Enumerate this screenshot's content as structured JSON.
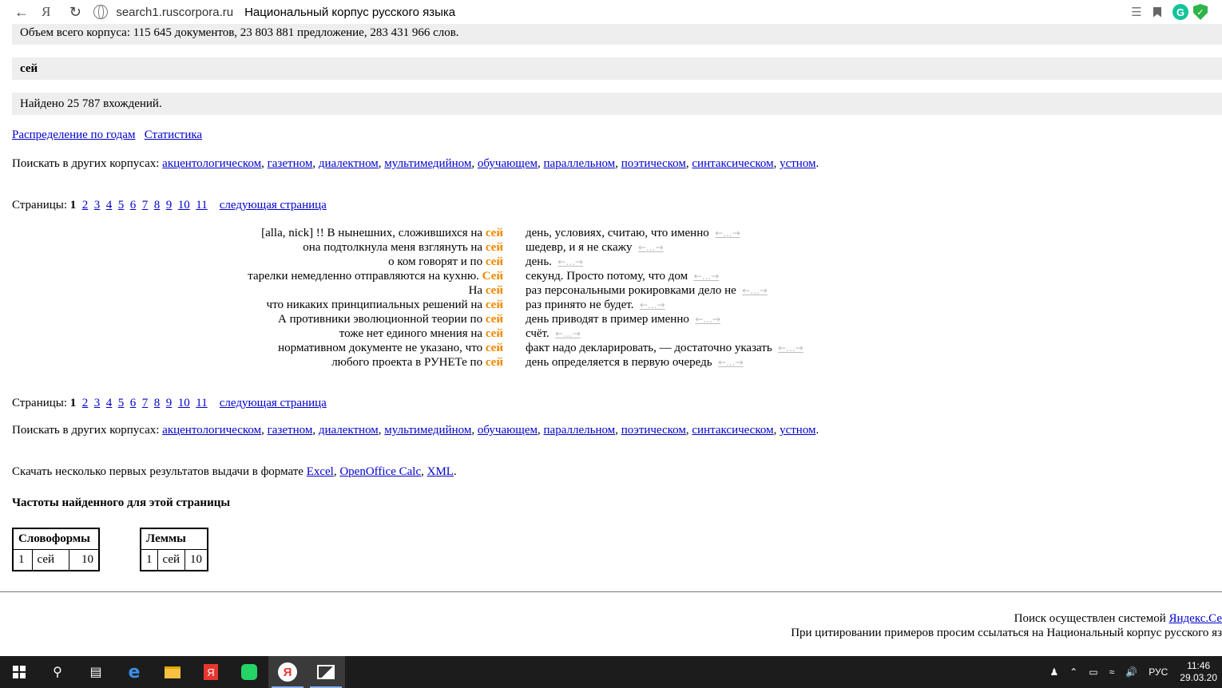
{
  "browser": {
    "url": "search1.ruscorpora.ru",
    "title": "Национальный корпус русского языка",
    "yandex_letter": "Я",
    "grammarly_letter": "G"
  },
  "summary": {
    "corpus_size": "Объем всего корпуса: 115 645 документов, 23 803 881 предложение, 283 431 966 слов.",
    "query": "сей",
    "found": "Найдено 25 787 вхождений."
  },
  "links": {
    "year_distribution": "Распределение по годам",
    "statistics": "Статистика"
  },
  "other_corpora": {
    "label": "Поискать в других корпусах:",
    "items": [
      "акцентологическом",
      "газетном",
      "диалектном",
      "мультимедийном",
      "обучающем",
      "параллельном",
      "поэтическом",
      "синтаксическом",
      "устном"
    ]
  },
  "pagination": {
    "label": "Страницы:",
    "current": "1",
    "pages": [
      "2",
      "3",
      "4",
      "5",
      "6",
      "7",
      "8",
      "9",
      "10",
      "11"
    ],
    "next": "следующая страница"
  },
  "kwic": [
    {
      "left": "[alla, nick] !! В нынешних, сложившихся на",
      "kw": "сей",
      "right": "день, условиях, считаю, что именно"
    },
    {
      "left": "она подтолкнула меня взглянуть на",
      "kw": "сей",
      "right": "шедевр, и я не скажу"
    },
    {
      "left": "о ком говорят и по",
      "kw": "сей",
      "right": "день."
    },
    {
      "left": "тарелки немедленно отправляются на кухню.",
      "kw": "Сей",
      "right": "секунд. Просто потому, что дом"
    },
    {
      "left": "На",
      "kw": "сей",
      "right": "раз персональными рокировками дело не"
    },
    {
      "left": "что никаких принципиальных решений на",
      "kw": "сей",
      "right": "раз принято не будет."
    },
    {
      "left": "А противники эволюционной теории по",
      "kw": "сей",
      "right": "день приводят в пример именно"
    },
    {
      "left": "тоже нет единого мнения на",
      "kw": "сей",
      "right": "счёт."
    },
    {
      "left": "нормативном документе не указано, что",
      "kw": "сей",
      "right": "факт надо декларировать, — достаточно указать"
    },
    {
      "left": "любого проекта в РУНЕТе по",
      "kw": "сей",
      "right": "день определяется в первую очередь"
    }
  ],
  "context_link": "←...→",
  "download": {
    "label": "Скачать несколько первых результатов выдачи в формате",
    "formats": [
      "Excel",
      "OpenOffice Calc",
      "XML"
    ]
  },
  "freq": {
    "heading": "Частоты найденного для этой страницы",
    "wordforms": {
      "title": "Словоформы",
      "rows": [
        {
          "n": "1",
          "word": "сей",
          "count": "10"
        }
      ]
    },
    "lemmas": {
      "title": "Леммы",
      "rows": [
        {
          "n": "1",
          "word": "сей",
          "count": "10"
        }
      ]
    }
  },
  "footer": {
    "search_by": "Поиск осуществлен системой",
    "search_link": "Яндекс.Се",
    "cite": "При цитировании примеров просим ссылаться на Национальный корпус русского яз"
  },
  "taskbar": {
    "lang": "РУС",
    "time": "11:46",
    "date": "29.03.20"
  },
  "colors": {
    "keyword": "#ee8800",
    "link": "#0000cc",
    "graybar": "#eeeeee"
  }
}
